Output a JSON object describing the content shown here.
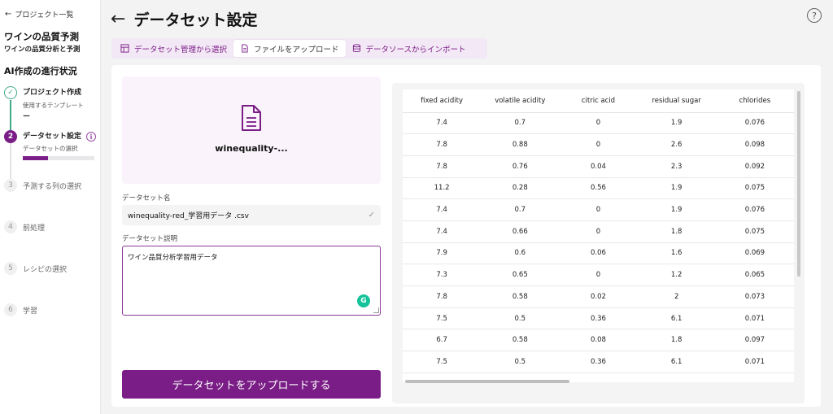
{
  "sidebar": {
    "back_label": "プロジェクト一覧",
    "project_title": "ワインの品質予測",
    "project_subtitle": "ワインの品質分析と予測",
    "progress_title": "AI作成の進行状況",
    "steps": [
      {
        "number": "✓",
        "label": "プロジェクト作成",
        "sub": "使用するテンプレート",
        "sub_value": "ー",
        "state": "done"
      },
      {
        "number": "2",
        "label": "データセット設定",
        "sub": "データセットの選択",
        "progress": 0.35,
        "state": "active"
      },
      {
        "number": "3",
        "label": "予測する列の選択",
        "state": "todo"
      },
      {
        "number": "4",
        "label": "前処理",
        "state": "todo"
      },
      {
        "number": "5",
        "label": "レシピの選択",
        "state": "todo"
      },
      {
        "number": "6",
        "label": "学習",
        "state": "todo"
      }
    ]
  },
  "header": {
    "title": "データセット設定"
  },
  "tabs": [
    {
      "label": "データセット管理から選択",
      "icon": "dataset-icon"
    },
    {
      "label": "ファイルをアップロード",
      "icon": "file-icon",
      "active": true
    },
    {
      "label": "データソースからインポート",
      "icon": "database-icon"
    }
  ],
  "upload": {
    "file_name": "winequality-...",
    "name_label": "データセット名",
    "name_value": "winequality-red_学習用データ .csv",
    "desc_label": "データセット説明",
    "desc_value": "ワイン品質分析学習用データ",
    "button_label": "データセットをアップロードする"
  },
  "table": {
    "columns": [
      "fixed acidity",
      "volatile acidity",
      "citric acid",
      "residual sugar",
      "chlorides"
    ],
    "rows": [
      [
        "7.4",
        "0.7",
        "0",
        "1.9",
        "0.076"
      ],
      [
        "7.8",
        "0.88",
        "0",
        "2.6",
        "0.098"
      ],
      [
        "7.8",
        "0.76",
        "0.04",
        "2.3",
        "0.092"
      ],
      [
        "11.2",
        "0.28",
        "0.56",
        "1.9",
        "0.075"
      ],
      [
        "7.4",
        "0.7",
        "0",
        "1.9",
        "0.076"
      ],
      [
        "7.4",
        "0.66",
        "0",
        "1.8",
        "0.075"
      ],
      [
        "7.9",
        "0.6",
        "0.06",
        "1.6",
        "0.069"
      ],
      [
        "7.3",
        "0.65",
        "0",
        "1.2",
        "0.065"
      ],
      [
        "7.8",
        "0.58",
        "0.02",
        "2",
        "0.073"
      ],
      [
        "7.5",
        "0.5",
        "0.36",
        "6.1",
        "0.071"
      ],
      [
        "6.7",
        "0.58",
        "0.08",
        "1.8",
        "0.097"
      ],
      [
        "7.5",
        "0.5",
        "0.36",
        "6.1",
        "0.071"
      ]
    ]
  },
  "colors": {
    "accent": "#7a1d86",
    "done": "#3fa98a"
  }
}
